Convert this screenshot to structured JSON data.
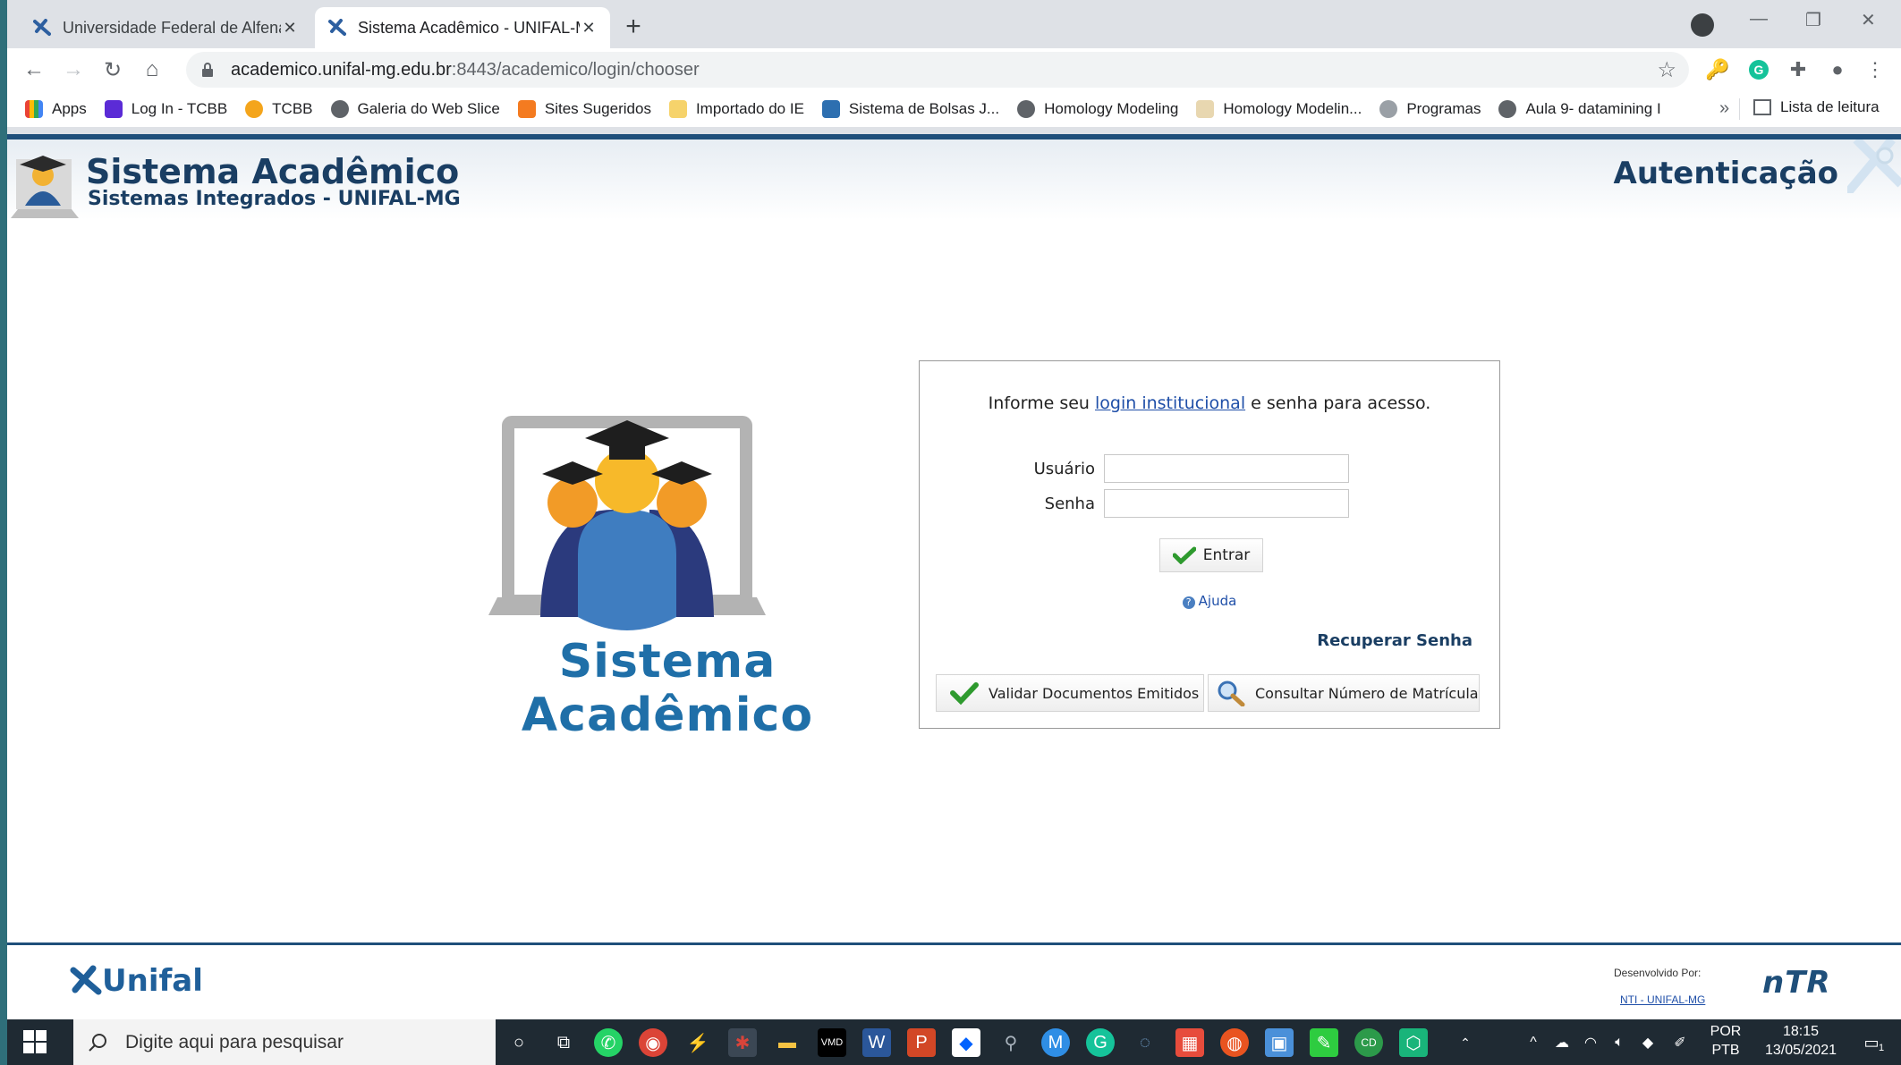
{
  "browser": {
    "tabs": [
      {
        "title": "Universidade Federal de Alfenas",
        "active": false
      },
      {
        "title": "Sistema Acadêmico - UNIFAL-MG",
        "active": true
      }
    ],
    "new_tab": "+",
    "address": {
      "host": "academico.unifal-mg.edu.br",
      "path": ":8443/academico/login/chooser"
    },
    "bookmarks": [
      {
        "label": "Apps",
        "color": "#ea4335"
      },
      {
        "label": "Log In - TCBB",
        "color": "#5b2bd6"
      },
      {
        "label": "TCBB",
        "color": "#f4a51c"
      },
      {
        "label": "Galeria do Web Slice",
        "color": "#5f6368"
      },
      {
        "label": "Sites Sugeridos",
        "color": "#f47b20"
      },
      {
        "label": "Importado do IE",
        "color": "#f6d36b"
      },
      {
        "label": "Sistema de Bolsas J...",
        "color": "#2d6fb0"
      },
      {
        "label": "Homology Modeling",
        "color": "#5f6368"
      },
      {
        "label": "Homology Modelin...",
        "color": "#e8d7b0"
      },
      {
        "label": "Programas",
        "color": "#9aa0a6"
      },
      {
        "label": "Aula 9- datamining I",
        "color": "#5f6368"
      }
    ],
    "bookmarks_more": "»",
    "reading_list": "Lista de leitura"
  },
  "header": {
    "title": "Sistema Acadêmico",
    "subtitle": "Sistemas Integrados - UNIFAL-MG",
    "page_title": "Autenticação"
  },
  "logo": {
    "text": "Sistema Acadêmico"
  },
  "login": {
    "message_prefix": "Informe seu ",
    "message_link": "login institucional",
    "message_suffix": " e senha para acesso.",
    "user_label": "Usuário",
    "user_value": "",
    "password_label": "Senha",
    "password_value": "",
    "submit_label": "Entrar",
    "help_label": "Ajuda",
    "recover_label": "Recuperar Senha",
    "validate_label": "Validar Documentos Emitidos",
    "lookup_label": "Consultar Número de Matrícula"
  },
  "footer": {
    "org_logo": "Unifal",
    "developed_by": "Desenvolvido Por:",
    "developer_link": "NTI - UNIFAL-MG",
    "developer_logo": "nTR"
  },
  "taskbar": {
    "search_placeholder": "Digite aqui para pesquisar",
    "lang_top": "POR",
    "lang_bottom": "PTB",
    "time": "18:15",
    "date": "13/05/2021",
    "notification_badge": "1"
  },
  "colors": {
    "brand_navy": "#1a3e63",
    "brand_blue": "#1f6fa8",
    "link": "#1f4fa8"
  }
}
